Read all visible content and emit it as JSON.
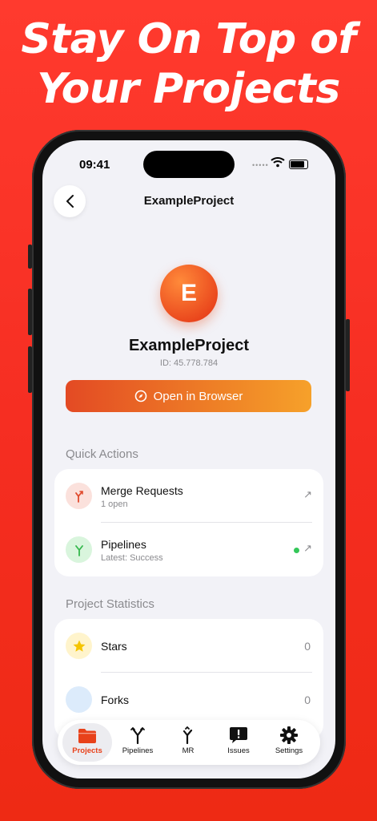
{
  "headline": {
    "line1": "Stay On Top of",
    "line2": "Your Projects"
  },
  "status_bar": {
    "time": "09:41",
    "dots": "•••••"
  },
  "nav": {
    "title": "ExampleProject"
  },
  "project": {
    "initial": "E",
    "name": "ExampleProject",
    "id": "ID: 45.778.784",
    "open_button": "Open in Browser"
  },
  "quick_actions": {
    "title": "Quick Actions",
    "items": [
      {
        "title": "Merge Requests",
        "subtitle": "1 open",
        "icon": "merge-icon",
        "arrow": "↗"
      },
      {
        "title": "Pipelines",
        "subtitle": "Latest: Success",
        "icon": "pipeline-icon",
        "arrow": "↗"
      }
    ]
  },
  "statistics": {
    "title": "Project Statistics",
    "items": [
      {
        "label": "Stars",
        "value": "0",
        "icon": "star-icon"
      },
      {
        "label": "Forks",
        "value": "0",
        "icon": "fork-icon"
      }
    ]
  },
  "tabs": [
    {
      "label": "Projects",
      "icon": "folder-icon",
      "active": true
    },
    {
      "label": "Pipelines",
      "icon": "pipeline-icon"
    },
    {
      "label": "MR",
      "icon": "merge-icon"
    },
    {
      "label": "Issues",
      "icon": "issue-icon"
    },
    {
      "label": "Settings",
      "icon": "gear-icon"
    }
  ],
  "colors": {
    "accent": "#e8411a",
    "background": "#f52d21",
    "success": "#34c759"
  }
}
